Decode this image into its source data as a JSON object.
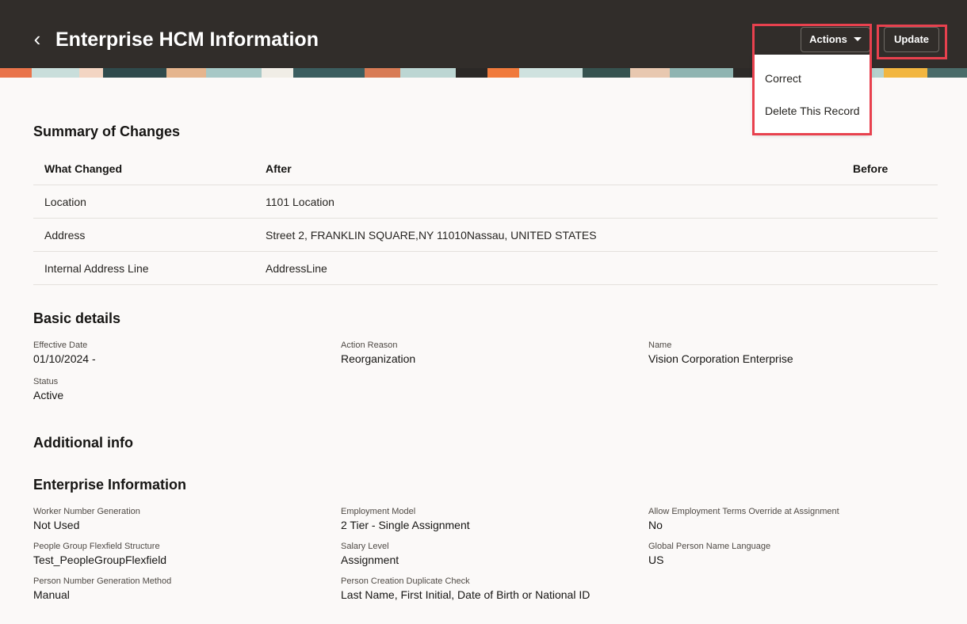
{
  "header": {
    "title": "Enterprise HCM Information",
    "actions_label": "Actions",
    "update_label": "Update"
  },
  "actions_menu": {
    "items": [
      "Correct",
      "Delete This Record"
    ]
  },
  "highlight_color": "#e8414e",
  "summary": {
    "title": "Summary of Changes",
    "columns": [
      "What Changed",
      "After",
      "Before"
    ],
    "rows": [
      {
        "what": "Location",
        "after": "1101 Location",
        "before": ""
      },
      {
        "what": "Address",
        "after": "Street 2, FRANKLIN SQUARE,NY 11010Nassau, UNITED STATES",
        "before": ""
      },
      {
        "what": "Internal Address Line",
        "after": "AddressLine",
        "before": ""
      }
    ]
  },
  "basic": {
    "title": "Basic details",
    "fields": [
      {
        "label": "Effective Date",
        "value": "01/10/2024 -"
      },
      {
        "label": "Action Reason",
        "value": "Reorganization"
      },
      {
        "label": "Name",
        "value": "Vision Corporation Enterprise"
      },
      {
        "label": "Status",
        "value": "Active"
      }
    ]
  },
  "additional": {
    "title": "Additional info"
  },
  "enterprise": {
    "title": "Enterprise Information",
    "fields": [
      {
        "label": "Worker Number Generation",
        "value": "Not Used"
      },
      {
        "label": "Employment Model",
        "value": "2 Tier - Single Assignment"
      },
      {
        "label": "Allow Employment Terms Override at Assignment",
        "value": "No"
      },
      {
        "label": "People Group Flexfield Structure",
        "value": "Test_PeopleGroupFlexfield"
      },
      {
        "label": "Salary Level",
        "value": "Assignment"
      },
      {
        "label": "Global Person Name Language",
        "value": "US"
      },
      {
        "label": "Person Number Generation Method",
        "value": "Manual"
      },
      {
        "label": "Person Creation Duplicate Check",
        "value": "Last Name, First Initial, Date of Birth or National ID"
      }
    ]
  }
}
